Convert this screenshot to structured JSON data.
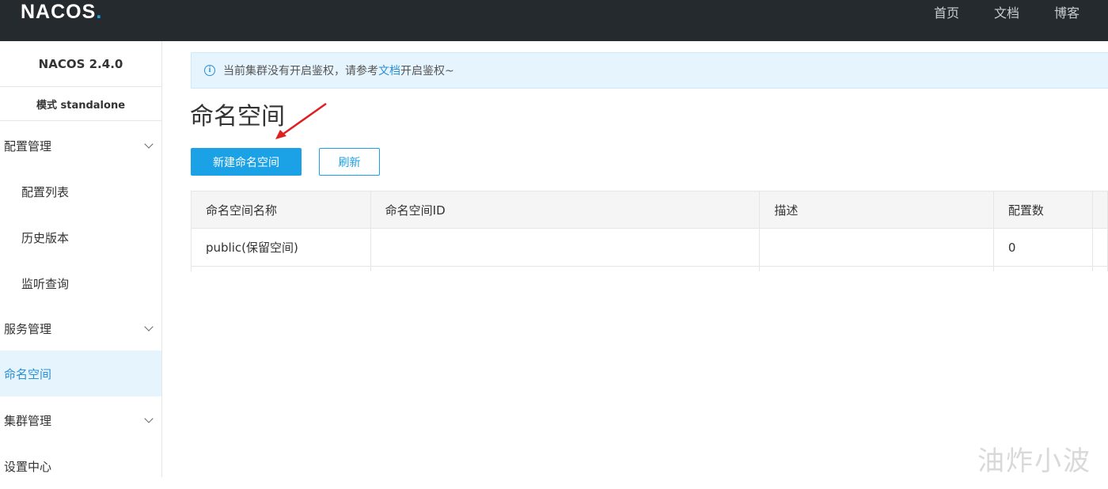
{
  "topbar": {
    "logo_main": "NAC",
    "logo_mid": "O",
    "logo_end": "S",
    "logo_dot": ".",
    "nav": [
      "首页",
      "文档",
      "博客"
    ]
  },
  "sidebar": {
    "version": "NACOS 2.4.0",
    "mode": "模式 standalone",
    "items": [
      {
        "label": "配置管理",
        "type": "group"
      },
      {
        "label": "配置列表",
        "type": "sub"
      },
      {
        "label": "历史版本",
        "type": "sub"
      },
      {
        "label": "监听查询",
        "type": "sub"
      },
      {
        "label": "服务管理",
        "type": "group"
      },
      {
        "label": "命名空间",
        "type": "active"
      },
      {
        "label": "集群管理",
        "type": "group"
      },
      {
        "label": "设置中心",
        "type": "plain"
      }
    ]
  },
  "notice": {
    "icon": "info-icon",
    "text_before": "当前集群没有开启鉴权，请参考",
    "link": "文档",
    "text_after": "开启鉴权~"
  },
  "page": {
    "title": "命名空间",
    "new_button": "新建命名空间",
    "refresh_button": "刷新"
  },
  "table": {
    "columns": [
      "命名空间名称",
      "命名空间ID",
      "描述",
      "配置数"
    ],
    "rows": [
      [
        "public(保留空间)",
        "",
        "",
        "0"
      ]
    ]
  },
  "watermark": "油炸小波",
  "colors": {
    "topbar": "#252a2f",
    "accent": "#1ba1e6",
    "active_bg": "#e6f4fd",
    "annotation_arrow": "#e02020"
  }
}
